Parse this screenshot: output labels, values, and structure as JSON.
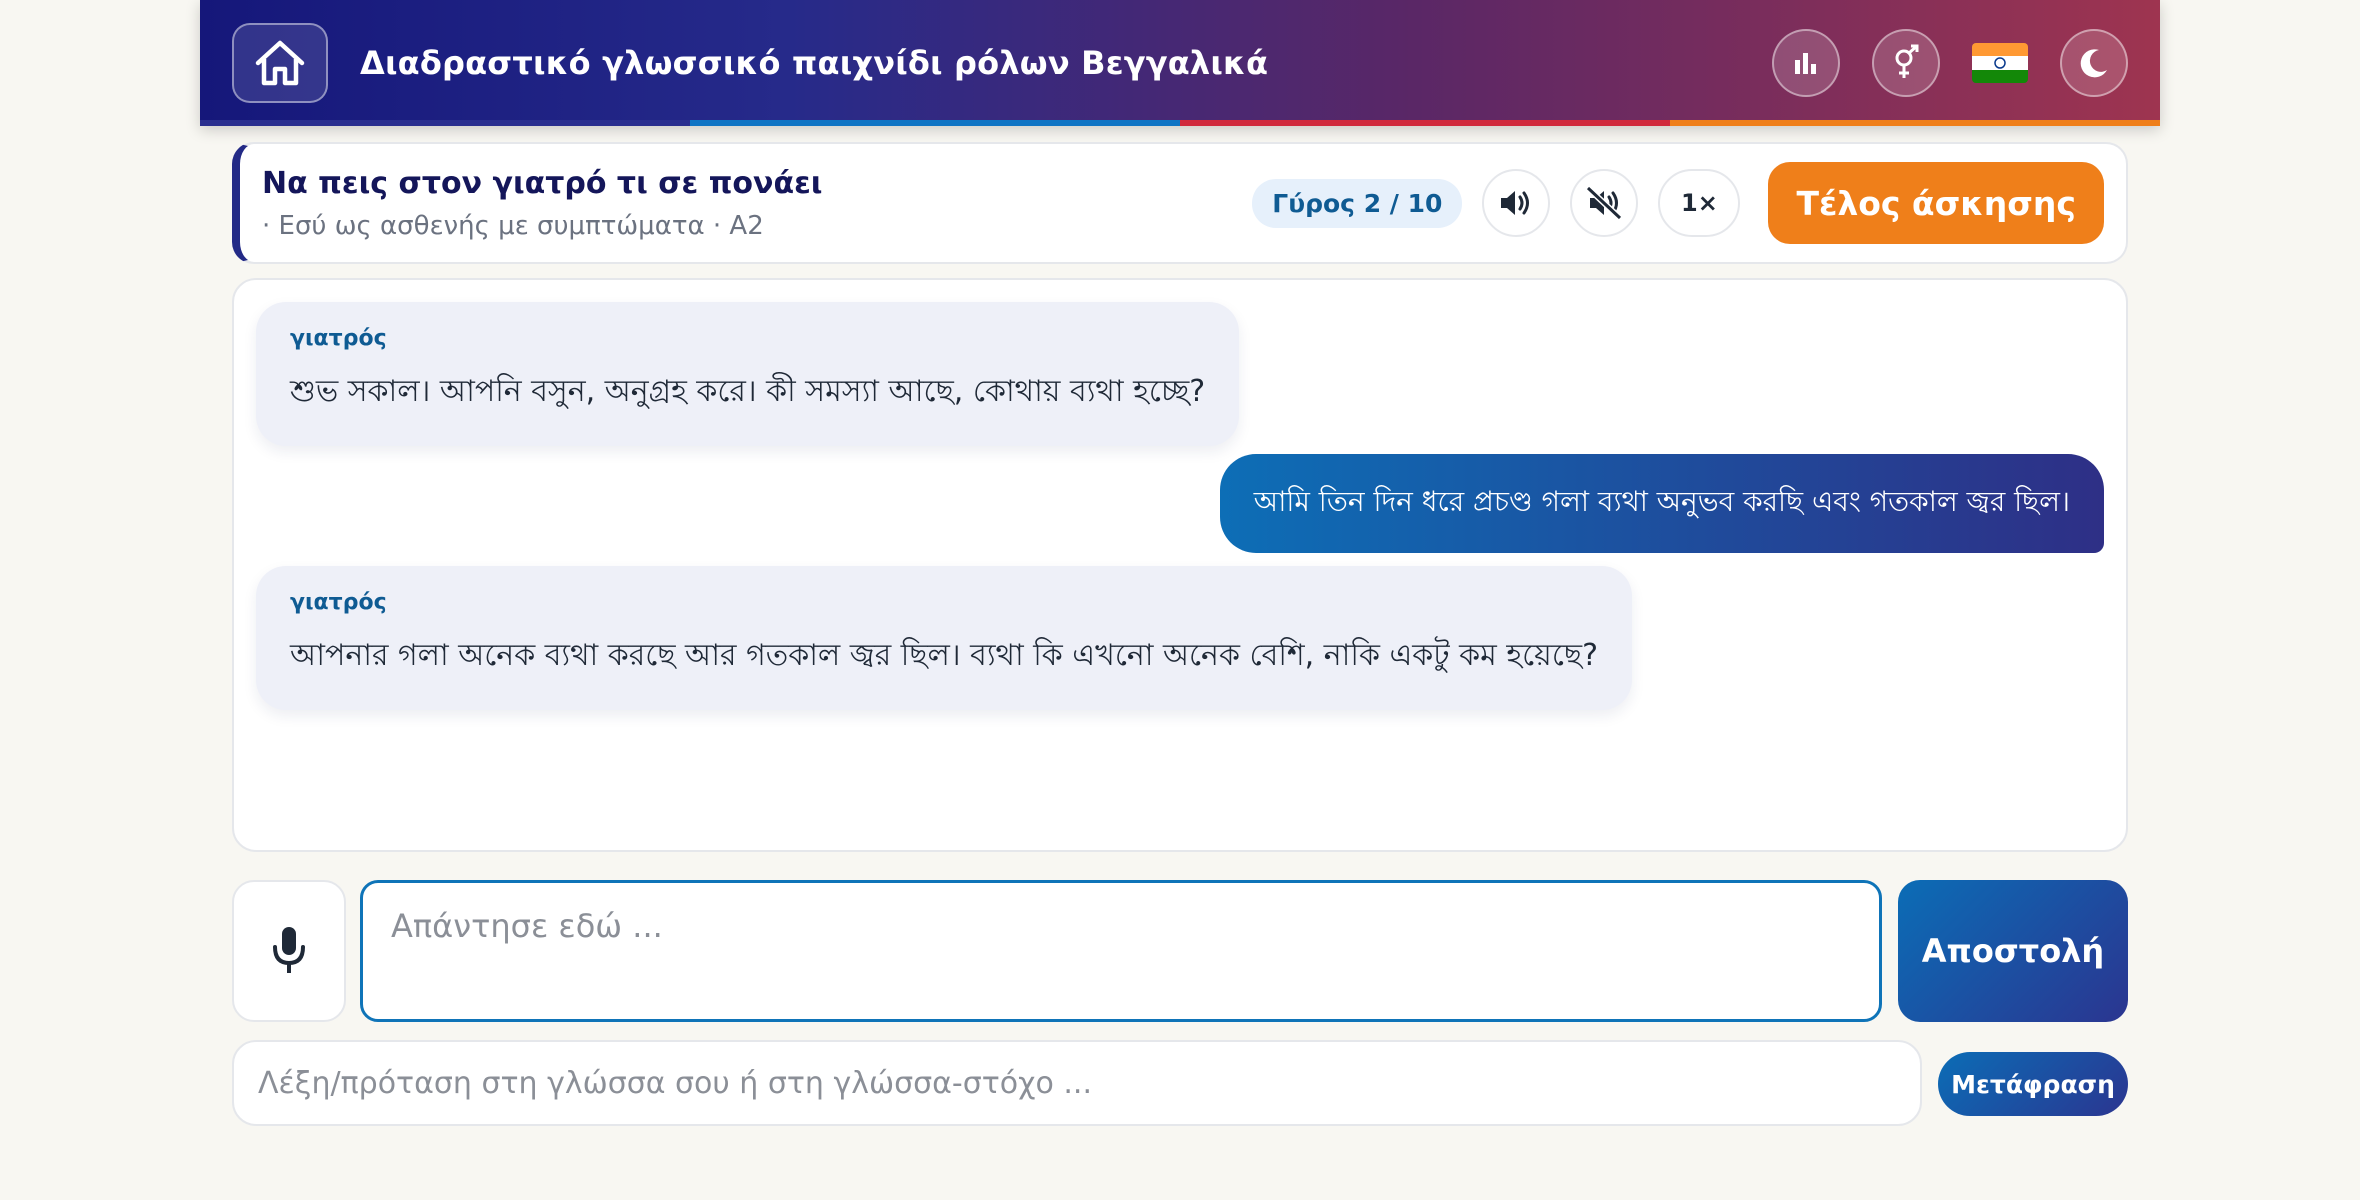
{
  "header": {
    "title": "Διαδραστικό γλωσσικό παιχνίδι ρόλων Βεγγαλικά",
    "icons": [
      "home-icon",
      "stats-icon",
      "gender-icon",
      "india-flag-icon",
      "moon-icon"
    ],
    "stripe_colors": [
      "#2a2f8f",
      "#0f74c4",
      "#d12a3d",
      "#ef7f1a"
    ]
  },
  "task": {
    "title": "Να πεις στον γιατρό τι σε πονάει",
    "subtitle": "· Εσύ ως ασθενής με συμπτώματα · A2",
    "round": "Γύρος 2 / 10",
    "speed": "1×",
    "end_label": "Τέλος άσκησης",
    "icons": [
      "volume-icon",
      "mute-icon"
    ]
  },
  "chat": {
    "messages": [
      {
        "role": "bot",
        "speaker": "γιατρός",
        "text": "শুভ সকাল। আপনি বসুন, অনুগ্রহ করে। কী সমস্যা আছে, কোথায় ব্যথা হচ্ছে?"
      },
      {
        "role": "user",
        "text": "আমি তিন দিন ধরে প্রচণ্ড গলা ব্যথা অনুভব করছি এবং গতকাল জ্বর ছিল।"
      },
      {
        "role": "bot",
        "speaker": "γιατρός",
        "text": "আপনার গলা অনেক ব্যথা করছে আর গতকাল জ্বর ছিল। ব্যথা কি এখনো অনেক বেশি, নাকি একটু কম হয়েছে?"
      }
    ]
  },
  "composer": {
    "placeholder": "Απάντησε εδώ ...",
    "send_label": "Αποστολή",
    "mic_icon": "microphone-icon"
  },
  "translate": {
    "placeholder": "Λέξη/πρόταση στη γλώσσα σου ή στη γλώσσα-στόχο ...",
    "button_label": "Μετάφραση"
  },
  "colors": {
    "accent_orange": "#ef7f1a",
    "primary_blue": "#0f74b8",
    "navy": "#232a86"
  }
}
